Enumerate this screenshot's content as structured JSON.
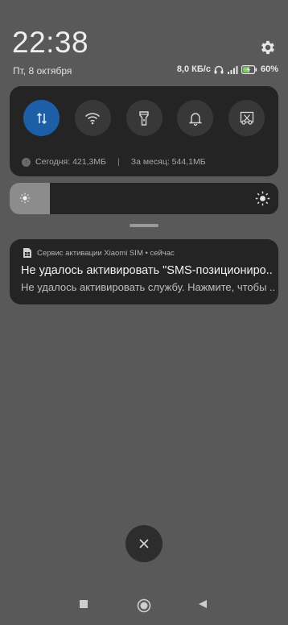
{
  "header": {
    "time": "22:38",
    "date": "Пт, 8 октября",
    "settings_icon": "gear-icon"
  },
  "status": {
    "speed": "8,0 КБ/с",
    "battery": "60"
  },
  "quick_settings": {
    "tiles": [
      {
        "name": "mobile-data",
        "icon": "arrows-updown-icon",
        "active": true
      },
      {
        "name": "wifi",
        "icon": "wifi-icon",
        "active": false
      },
      {
        "name": "flashlight",
        "icon": "flashlight-icon",
        "active": false
      },
      {
        "name": "sound",
        "icon": "bell-icon",
        "active": false
      },
      {
        "name": "screenshot",
        "icon": "scissors-icon",
        "active": false
      }
    ],
    "traffic_today": "Сегодня: 421,3МБ",
    "traffic_separator": "|",
    "traffic_month": "За месяц: 544,1МБ"
  },
  "brightness": {
    "level": 0.15
  },
  "notification": {
    "app_line": "Сервис активации Xiaomi SIM • сейчас",
    "title": "Не удалось активировать \"SMS-позиционирование\"",
    "body": "Не удалось активировать службу. Нажмите, чтобы повторить."
  },
  "colors": {
    "active_tile": "#1d5fa6",
    "background": "#595959",
    "panel": "#242424"
  }
}
